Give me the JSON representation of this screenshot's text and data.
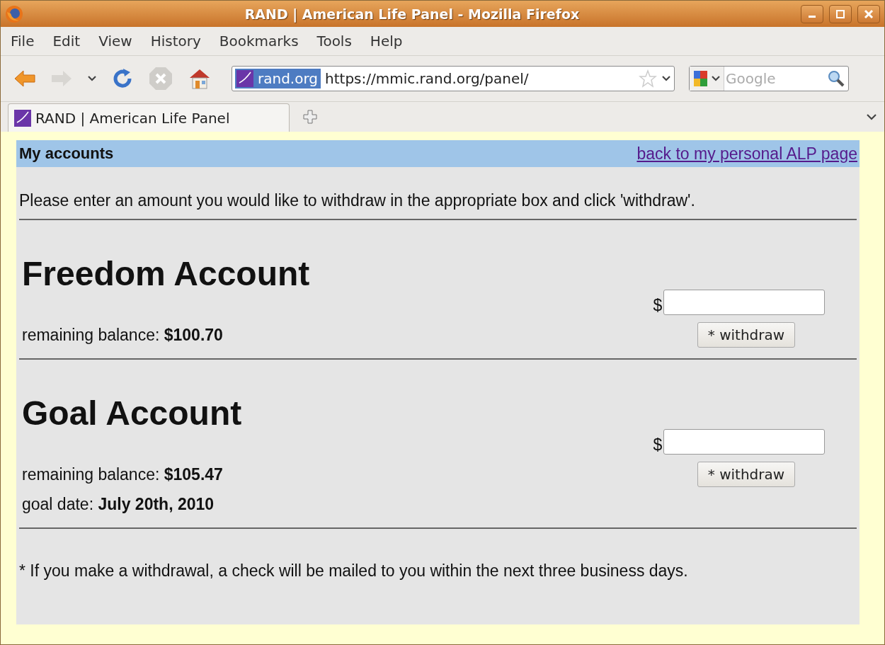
{
  "window": {
    "title": "RAND | American Life Panel - Mozilla Firefox"
  },
  "menu": [
    "File",
    "Edit",
    "View",
    "History",
    "Bookmarks",
    "Tools",
    "Help"
  ],
  "address_bar": {
    "site": "rand.org",
    "url": "https://mmic.rand.org/panel/"
  },
  "search": {
    "placeholder": "Google"
  },
  "tabs": [
    {
      "label": "RAND | American Life Panel",
      "selected": true
    }
  ],
  "page": {
    "header": "My accounts",
    "back_link": "back to my personal ALP page",
    "instructions": "Please enter an amount you would like to withdraw in the appropriate box and click 'withdraw'.",
    "accounts": [
      {
        "name": "Freedom Account",
        "details": [
          "remaining balance: **$100.70**"
        ],
        "currency": "$",
        "button": "* withdraw"
      },
      {
        "name": "Goal Account",
        "details": [
          "remaining balance: **$105.47**",
          "goal date: **July 20th, 2010**"
        ],
        "currency": "$",
        "button": "* withdraw"
      }
    ],
    "footnote": "* If you make a withdrawal, a check will be mailed to you within the next three business days."
  }
}
